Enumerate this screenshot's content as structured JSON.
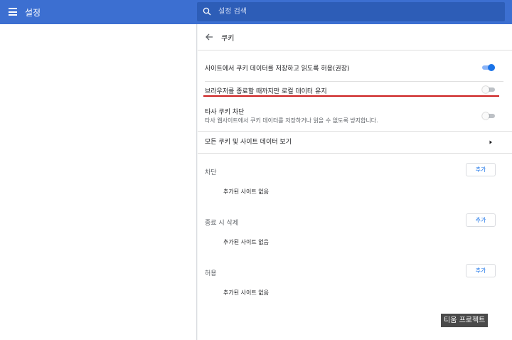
{
  "header": {
    "title": "설정",
    "menu_icon": "hamburger-menu-icon",
    "search": {
      "placeholder": "설정 검색",
      "value": "",
      "icon": "search-icon"
    }
  },
  "page": {
    "title": "쿠키",
    "back_icon": "arrow-back-icon",
    "settings": [
      {
        "label": "사이트에서 쿠키 데이터를 저장하고 읽도록 허용(권장)",
        "enabled": true
      },
      {
        "label": "브라우저를 종료할 때까지만 로컬 데이터 유지",
        "enabled": false,
        "highlighted": true
      },
      {
        "label": "타사 쿠키 차단",
        "sub": "타사 웹사이트에서 쿠키 데이터를 저장하거나 읽을 수 없도록 방지합니다.",
        "enabled": false
      }
    ],
    "view_all": {
      "label": "모든 쿠키 및 사이트 데이터 보기",
      "icon": "chevron-right-icon"
    },
    "sections": [
      {
        "title": "차단",
        "add_label": "추가",
        "empty": "추가된 사이트 없음"
      },
      {
        "title": "종료 시 삭제",
        "add_label": "추가",
        "empty": "추가된 사이트 없음"
      },
      {
        "title": "허용",
        "add_label": "추가",
        "empty": "추가된 사이트 없음"
      }
    ]
  },
  "watermark": "티움 프로젝트",
  "colors": {
    "header": "#3c6fd1",
    "search": "#2d5db7",
    "accent": "#1a73e8",
    "highlight": "#cc1f1f"
  }
}
